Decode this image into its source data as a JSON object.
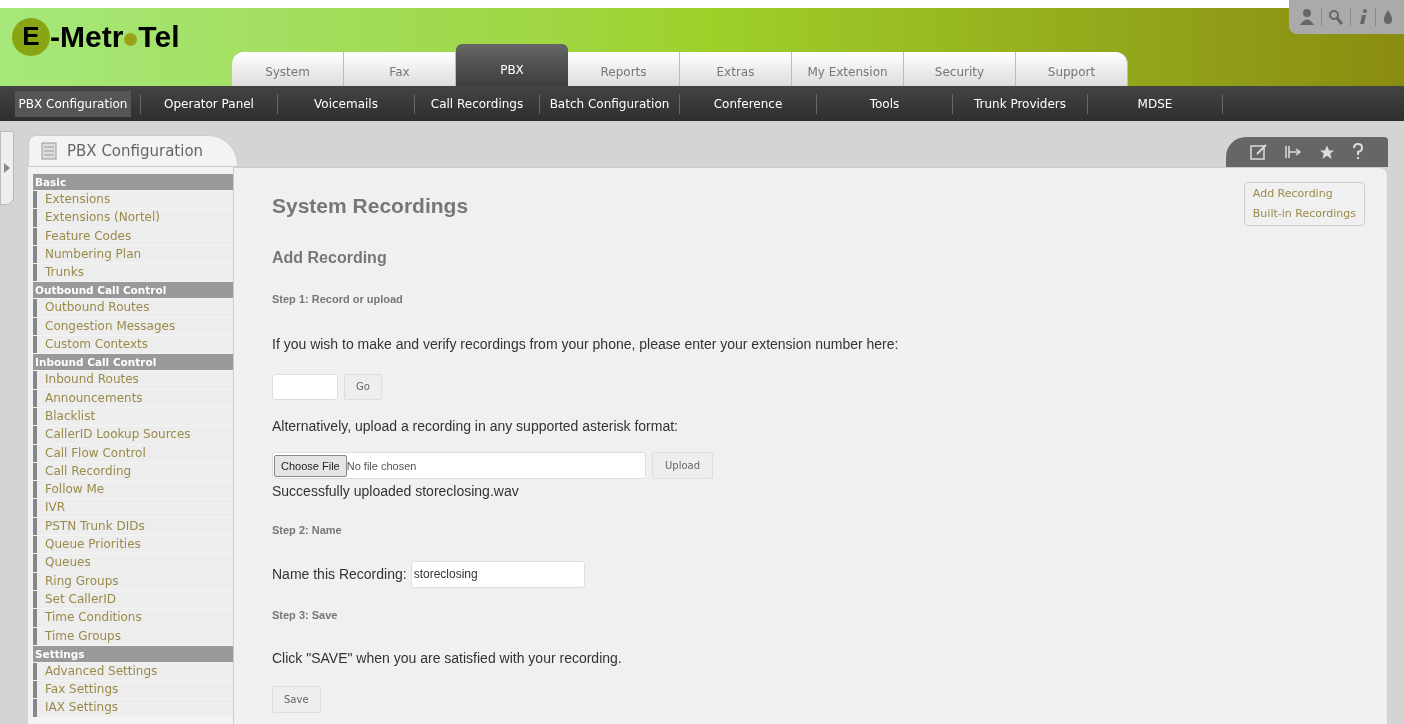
{
  "logo": {
    "initial": "E",
    "left": "-Metr",
    "right": "Tel"
  },
  "tabs": [
    {
      "label": "System",
      "selected": false
    },
    {
      "label": "Fax",
      "selected": false
    },
    {
      "label": "PBX",
      "selected": true
    },
    {
      "label": "Reports",
      "selected": false
    },
    {
      "label": "Extras",
      "selected": false
    },
    {
      "label": "My Extension",
      "selected": false
    },
    {
      "label": "Security",
      "selected": false
    },
    {
      "label": "Support",
      "selected": false
    }
  ],
  "subnav": [
    {
      "label": "PBX Configuration",
      "selected": true
    },
    {
      "label": "Operator Panel",
      "selected": false
    },
    {
      "label": "Voicemails",
      "selected": false
    },
    {
      "label": "Call Recordings",
      "selected": false
    },
    {
      "label": "Batch Configuration",
      "selected": false
    },
    {
      "label": "Conference",
      "selected": false
    },
    {
      "label": "Tools",
      "selected": false
    },
    {
      "label": "Trunk Providers",
      "selected": false
    },
    {
      "label": "MDSE",
      "selected": false
    }
  ],
  "panel_tab": "PBX Configuration",
  "sidebar": {
    "items": [
      {
        "kind": "header",
        "label": "Basic"
      },
      {
        "kind": "link",
        "label": "Extensions"
      },
      {
        "kind": "link",
        "label": "Extensions (Nortel)"
      },
      {
        "kind": "link",
        "label": "Feature Codes"
      },
      {
        "kind": "link",
        "label": "Numbering Plan"
      },
      {
        "kind": "link",
        "label": "Trunks"
      },
      {
        "kind": "header",
        "label": "Outbound Call Control"
      },
      {
        "kind": "link",
        "label": "Outbound Routes"
      },
      {
        "kind": "link",
        "label": "Congestion Messages"
      },
      {
        "kind": "link",
        "label": "Custom Contexts"
      },
      {
        "kind": "header",
        "label": "Inbound Call Control"
      },
      {
        "kind": "link",
        "label": "Inbound Routes"
      },
      {
        "kind": "link",
        "label": "Announcements"
      },
      {
        "kind": "link",
        "label": "Blacklist"
      },
      {
        "kind": "link",
        "label": "CallerID Lookup Sources"
      },
      {
        "kind": "link",
        "label": "Call Flow Control"
      },
      {
        "kind": "link",
        "label": "Call Recording"
      },
      {
        "kind": "link",
        "label": "Follow Me"
      },
      {
        "kind": "link",
        "label": "IVR"
      },
      {
        "kind": "link",
        "label": "PSTN Trunk DIDs"
      },
      {
        "kind": "link",
        "label": "Queue Priorities"
      },
      {
        "kind": "link",
        "label": "Queues"
      },
      {
        "kind": "link",
        "label": "Ring Groups"
      },
      {
        "kind": "link",
        "label": "Set CallerID"
      },
      {
        "kind": "link",
        "label": "Time Conditions"
      },
      {
        "kind": "link",
        "label": "Time Groups"
      },
      {
        "kind": "header",
        "label": "Settings"
      },
      {
        "kind": "link",
        "label": "Advanced Settings"
      },
      {
        "kind": "link",
        "label": "Fax Settings"
      },
      {
        "kind": "link",
        "label": "IAX Settings"
      }
    ]
  },
  "content": {
    "title": "System Recordings",
    "subtitle": "Add Recording",
    "step1": "Step 1: Record or upload",
    "phone_prompt": "If you wish to make and verify recordings from your phone, please enter your extension number here:",
    "go_button": "Go",
    "upload_prompt": "Alternatively, upload a recording in any supported asterisk format:",
    "choose_file_button": "Choose File",
    "file_status": "No file chosen",
    "upload_button": "Upload",
    "upload_message": "Successfully uploaded storeclosing.wav",
    "step2": "Step 2: Name",
    "name_label": "Name this Recording:",
    "name_value": "storeclosing",
    "step3": "Step 3: Save",
    "save_prompt": "Click \"SAVE\" when you are satisfied with your recording.",
    "save_button": "Save"
  },
  "side_links": [
    "Add Recording",
    "Built-in Recordings"
  ]
}
